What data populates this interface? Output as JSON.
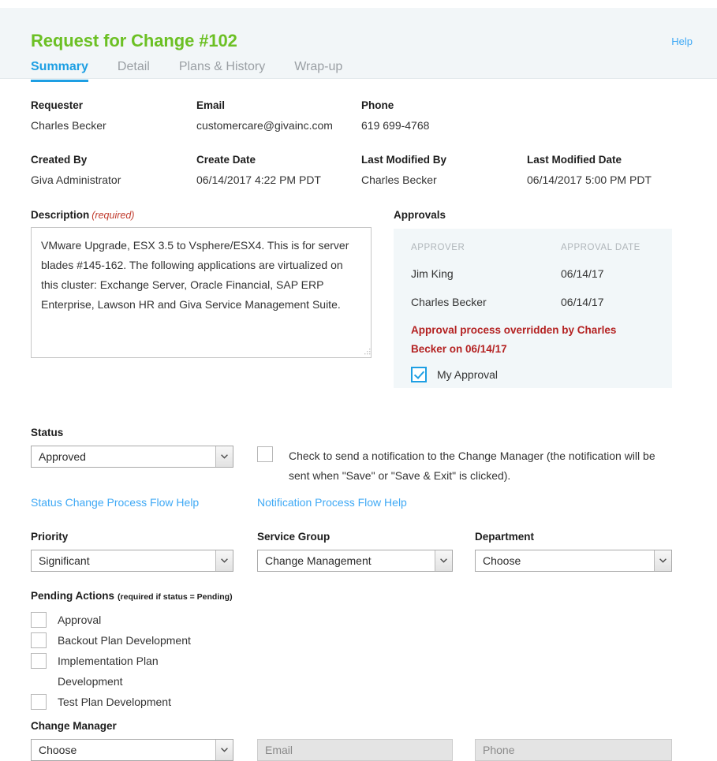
{
  "header": {
    "title": "Request for Change #102",
    "help_label": "Help",
    "tabs": [
      {
        "label": "Summary",
        "active": true
      },
      {
        "label": "Detail",
        "active": false
      },
      {
        "label": "Plans & History",
        "active": false
      },
      {
        "label": "Wrap-up",
        "active": false
      }
    ],
    "accent_green": "#6cc024",
    "accent_blue": "#1e9fe3"
  },
  "info_fields": [
    {
      "label": "Requester",
      "value": "Charles Becker"
    },
    {
      "label": "Email",
      "value": "customercare@givainc.com"
    },
    {
      "label": "Phone",
      "value": "619 699-4768"
    },
    {
      "label": "Created By",
      "value": "Giva Administrator"
    },
    {
      "label": "Create Date",
      "value": "06/14/2017 4:22 PM PDT"
    },
    {
      "label": "Last Modified By",
      "value": "Charles Becker"
    },
    {
      "label": "Last Modified Date",
      "value": "06/14/2017 5:00 PM PDT"
    }
  ],
  "description": {
    "label": "Description",
    "required_note": "(required)",
    "value": "VMware Upgrade, ESX 3.5 to Vsphere/ESX4. This is for server blades #145-162. The following applications are virtualized on this cluster: Exchange Server, Oracle Financial, SAP ERP Enterprise, Lawson HR and Giva Service Management Suite."
  },
  "approvals": {
    "heading": "Approvals",
    "columns": [
      "APPROVER",
      "APPROVAL DATE"
    ],
    "rows": [
      {
        "approver": "Jim King",
        "date": "06/14/17"
      },
      {
        "approver": "Charles Becker",
        "date": "06/14/17"
      }
    ],
    "override_note": "Approval process overridden by Charles Becker on 06/14/17",
    "override_color": "#b42222",
    "my_approval_label": "My Approval",
    "my_approval_checked": true,
    "panel_bg": "#f2f7f9"
  },
  "status": {
    "label": "Status",
    "value": "Approved",
    "help_link": "Status Change Process Flow Help"
  },
  "notification": {
    "checked": false,
    "text": "Check to send a notification to the Change Manager (the notification will be sent when \"Save\" or \"Save & Exit\" is clicked).",
    "help_link": "Notification Process Flow Help"
  },
  "priority": {
    "label": "Priority",
    "value": "Significant"
  },
  "service_group": {
    "label": "Service Group",
    "value": "Change Management"
  },
  "department": {
    "label": "Department",
    "value": "Choose"
  },
  "pending_actions": {
    "label": "Pending Actions",
    "note": "(required if status = Pending)",
    "items": [
      {
        "label": "Approval",
        "checked": false,
        "has_checkbox": true
      },
      {
        "label": "Backout Plan Development",
        "checked": false,
        "has_checkbox": true
      },
      {
        "label": "Implementation Plan",
        "checked": false,
        "has_checkbox": true
      },
      {
        "label": "Development",
        "checked": false,
        "has_checkbox": false
      },
      {
        "label": "Test Plan Development",
        "checked": false,
        "has_checkbox": true
      }
    ]
  },
  "change_manager": {
    "label": "Change Manager",
    "value": "Choose",
    "email_placeholder": "Email",
    "phone_placeholder": "Phone"
  }
}
